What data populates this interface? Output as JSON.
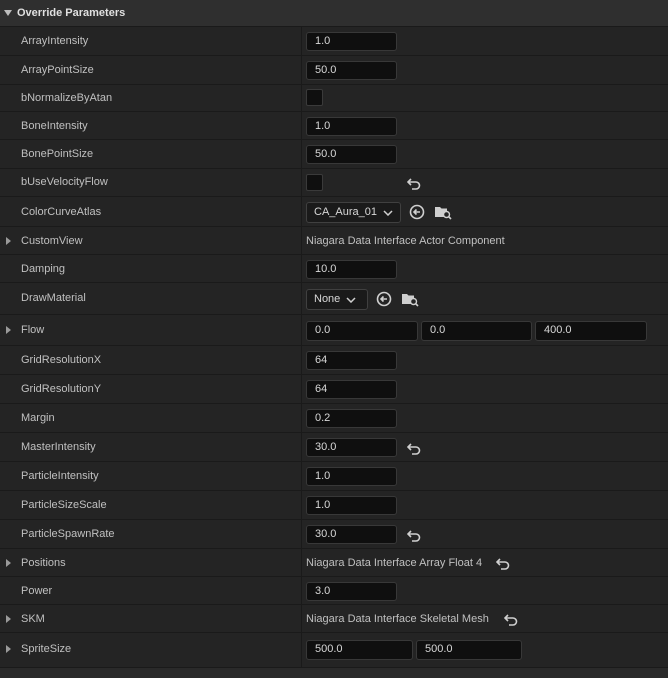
{
  "section": {
    "title": "Override Parameters"
  },
  "rows": {
    "array_intensity": {
      "label": "ArrayIntensity",
      "value": "1.0"
    },
    "array_point_size": {
      "label": "ArrayPointSize",
      "value": "50.0"
    },
    "b_normalize_by_atan": {
      "label": "bNormalizeByAtan",
      "checked": false
    },
    "bone_intensity": {
      "label": "BoneIntensity",
      "value": "1.0"
    },
    "bone_point_size": {
      "label": "BonePointSize",
      "value": "50.0"
    },
    "b_use_velocity_flow": {
      "label": "bUseVelocityFlow",
      "checked": false
    },
    "color_curve_atlas": {
      "label": "ColorCurveAtlas",
      "value": "CA_Aura_01"
    },
    "custom_view": {
      "label": "CustomView",
      "value": "Niagara Data Interface Actor Component"
    },
    "damping": {
      "label": "Damping",
      "value": "10.0"
    },
    "draw_material": {
      "label": "DrawMaterial",
      "value": "None"
    },
    "flow": {
      "label": "Flow",
      "x": "0.0",
      "y": "0.0",
      "z": "400.0"
    },
    "grid_resolution_x": {
      "label": "GridResolutionX",
      "value": "64"
    },
    "grid_resolution_y": {
      "label": "GridResolutionY",
      "value": "64"
    },
    "margin": {
      "label": "Margin",
      "value": "0.2"
    },
    "master_intensity": {
      "label": "MasterIntensity",
      "value": "30.0"
    },
    "particle_intensity": {
      "label": "ParticleIntensity",
      "value": "1.0"
    },
    "particle_size_scale": {
      "label": "ParticleSizeScale",
      "value": "1.0"
    },
    "particle_spawn_rate": {
      "label": "ParticleSpawnRate",
      "value": "30.0"
    },
    "positions": {
      "label": "Positions",
      "value": "Niagara Data Interface Array Float 4"
    },
    "power": {
      "label": "Power",
      "value": "3.0"
    },
    "skm": {
      "label": "SKM",
      "value": "Niagara Data Interface Skeletal Mesh"
    },
    "sprite_size": {
      "label": "SpriteSize",
      "x": "500.0",
      "y": "500.0"
    }
  },
  "icons": {
    "reset": "reset-to-default-icon",
    "use_selected": "use-selected-asset-icon",
    "browse": "browse-asset-icon",
    "expander": "expander-arrow-icon"
  },
  "colors": {
    "background": "#242424",
    "field": "#0f0f0f",
    "header": "#2f2f2f"
  }
}
